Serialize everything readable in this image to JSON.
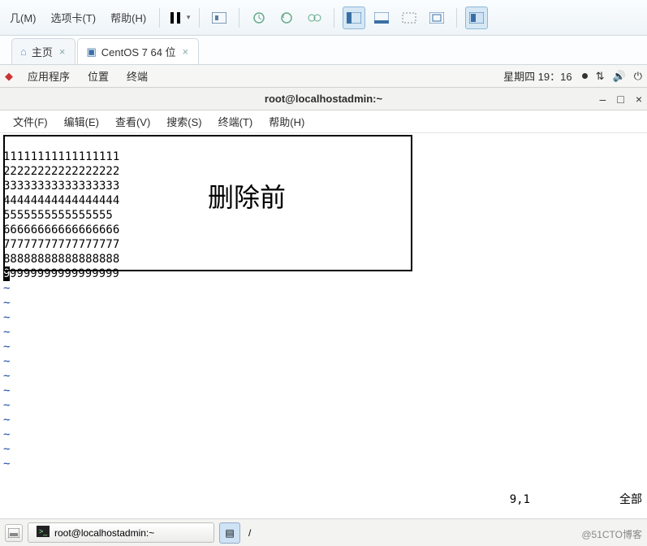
{
  "host_menu": {
    "m1": "几(M)",
    "m2": "选项卡(T)",
    "m3": "帮助(H)"
  },
  "tabs": {
    "home": "主页",
    "vm": "CentOS 7 64 位"
  },
  "gnome": {
    "apps": "应用程序",
    "places": "位置",
    "terminal": "终端",
    "clock": "星期四 19：16"
  },
  "terminal": {
    "title": "root@localhostadmin:~",
    "menu": {
      "file": "文件(F)",
      "edit": "编辑(E)",
      "view": "查看(V)",
      "search": "搜索(S)",
      "terminal": "终端(T)",
      "help": "帮助(H)"
    },
    "lines": [
      "11111111111111111",
      "22222222222222222",
      "33333333333333333",
      "44444444444444444",
      "5555555555555555",
      "66666666666666666",
      "77777777777777777",
      "88888888888888888"
    ],
    "last_line_cursor": "9",
    "last_line_rest": "9999999999999999",
    "annotation_label": "删除前",
    "status_pos": "9,1",
    "status_right": "全部"
  },
  "taskbar": {
    "window1": "root@localhostadmin:~",
    "window2": "/"
  },
  "watermark": "@51CTO博客"
}
